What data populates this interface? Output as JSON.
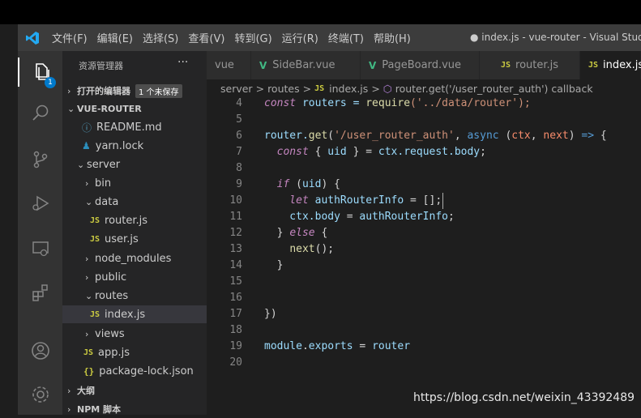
{
  "window": {
    "title": "● index.js - vue-router - Visual Studio C",
    "menu": [
      "文件(F)",
      "编辑(E)",
      "选择(S)",
      "查看(V)",
      "转到(G)",
      "运行(R)",
      "终端(T)",
      "帮助(H)"
    ]
  },
  "activity_bar": {
    "badge_count": "1",
    "icons": [
      "files-icon",
      "search-icon",
      "source-control-icon",
      "run-debug-icon",
      "remote-explorer-icon",
      "extensions-icon",
      "account-icon",
      "settings-gear-icon"
    ]
  },
  "sidebar": {
    "header": "资源管理器",
    "more": "···",
    "open_editors": {
      "label": "打开的编辑器",
      "badge": "1 个未保存"
    },
    "project": "VUE-ROUTER",
    "items": [
      {
        "label": "README.md"
      },
      {
        "label": "yarn.lock"
      },
      {
        "label": "server"
      },
      {
        "label": "bin"
      },
      {
        "label": "data"
      },
      {
        "label": "router.js"
      },
      {
        "label": "user.js"
      },
      {
        "label": "node_modules"
      },
      {
        "label": "public"
      },
      {
        "label": "routes"
      },
      {
        "label": "index.js"
      },
      {
        "label": "views"
      },
      {
        "label": "app.js"
      },
      {
        "label": "package-lock.json"
      }
    ],
    "outline": "大纲",
    "npm": "NPM 脚本"
  },
  "tabs": [
    {
      "label": "vue",
      "icon": ""
    },
    {
      "label": "SideBar.vue",
      "icon": "V"
    },
    {
      "label": "PageBoard.vue",
      "icon": "V"
    },
    {
      "label": "router.js",
      "icon": "JS"
    },
    {
      "label": "index.js",
      "icon": "JS"
    }
  ],
  "breadcrumb": {
    "parts": [
      "server",
      "routes",
      "index.js",
      "router.get('/user_router_auth') callback"
    ],
    "sep": ">"
  },
  "code": {
    "line_numbers": [
      "4",
      "5",
      "6",
      "7",
      "8",
      "9",
      "10",
      "11",
      "12",
      "13",
      "14",
      "15",
      "16",
      "17",
      "18",
      "19",
      "20"
    ],
    "l4": {
      "a": "const",
      "b": " routers = ",
      "c": "require",
      "d": "('../data/router');"
    },
    "l6": {
      "a": "router.",
      "b": "get",
      "c": "(",
      "d": "'/user_router_auth'",
      "e": ", ",
      "f": "async",
      "g": " (",
      "h": "ctx",
      "i": ", ",
      "j": "next",
      "k": ") ",
      "l": "=>",
      "m": " {"
    },
    "l7": {
      "a": "  const",
      "b": " { ",
      "c": "uid",
      "d": " } = ",
      "e": "ctx.request.body",
      "f": ";"
    },
    "l9": {
      "a": "  if",
      "b": " (",
      "c": "uid",
      "d": ") {"
    },
    "l10": {
      "a": "    let",
      "b": " ",
      "c": "authRouterInfo",
      "d": " = [];"
    },
    "l11": {
      "a": "    ctx.body",
      "b": " = ",
      "c": "authRouterInfo",
      "d": ";"
    },
    "l12": {
      "a": "  } ",
      "b": "else",
      "c": " {"
    },
    "l13": {
      "a": "    ",
      "b": "next",
      "c": "();"
    },
    "l14": {
      "a": "  }"
    },
    "l17": {
      "a": "})"
    },
    "l19": {
      "a": "module",
      "b": ".",
      "c": "exports",
      "d": " = ",
      "e": "router"
    }
  },
  "watermark": "https://blog.csdn.net/weixin_43392489",
  "colors": {
    "accent": "#007acc",
    "keyword": "#569cd6",
    "string": "#ce9178",
    "function": "#dcdcaa",
    "variable": "#9cdcfe"
  }
}
